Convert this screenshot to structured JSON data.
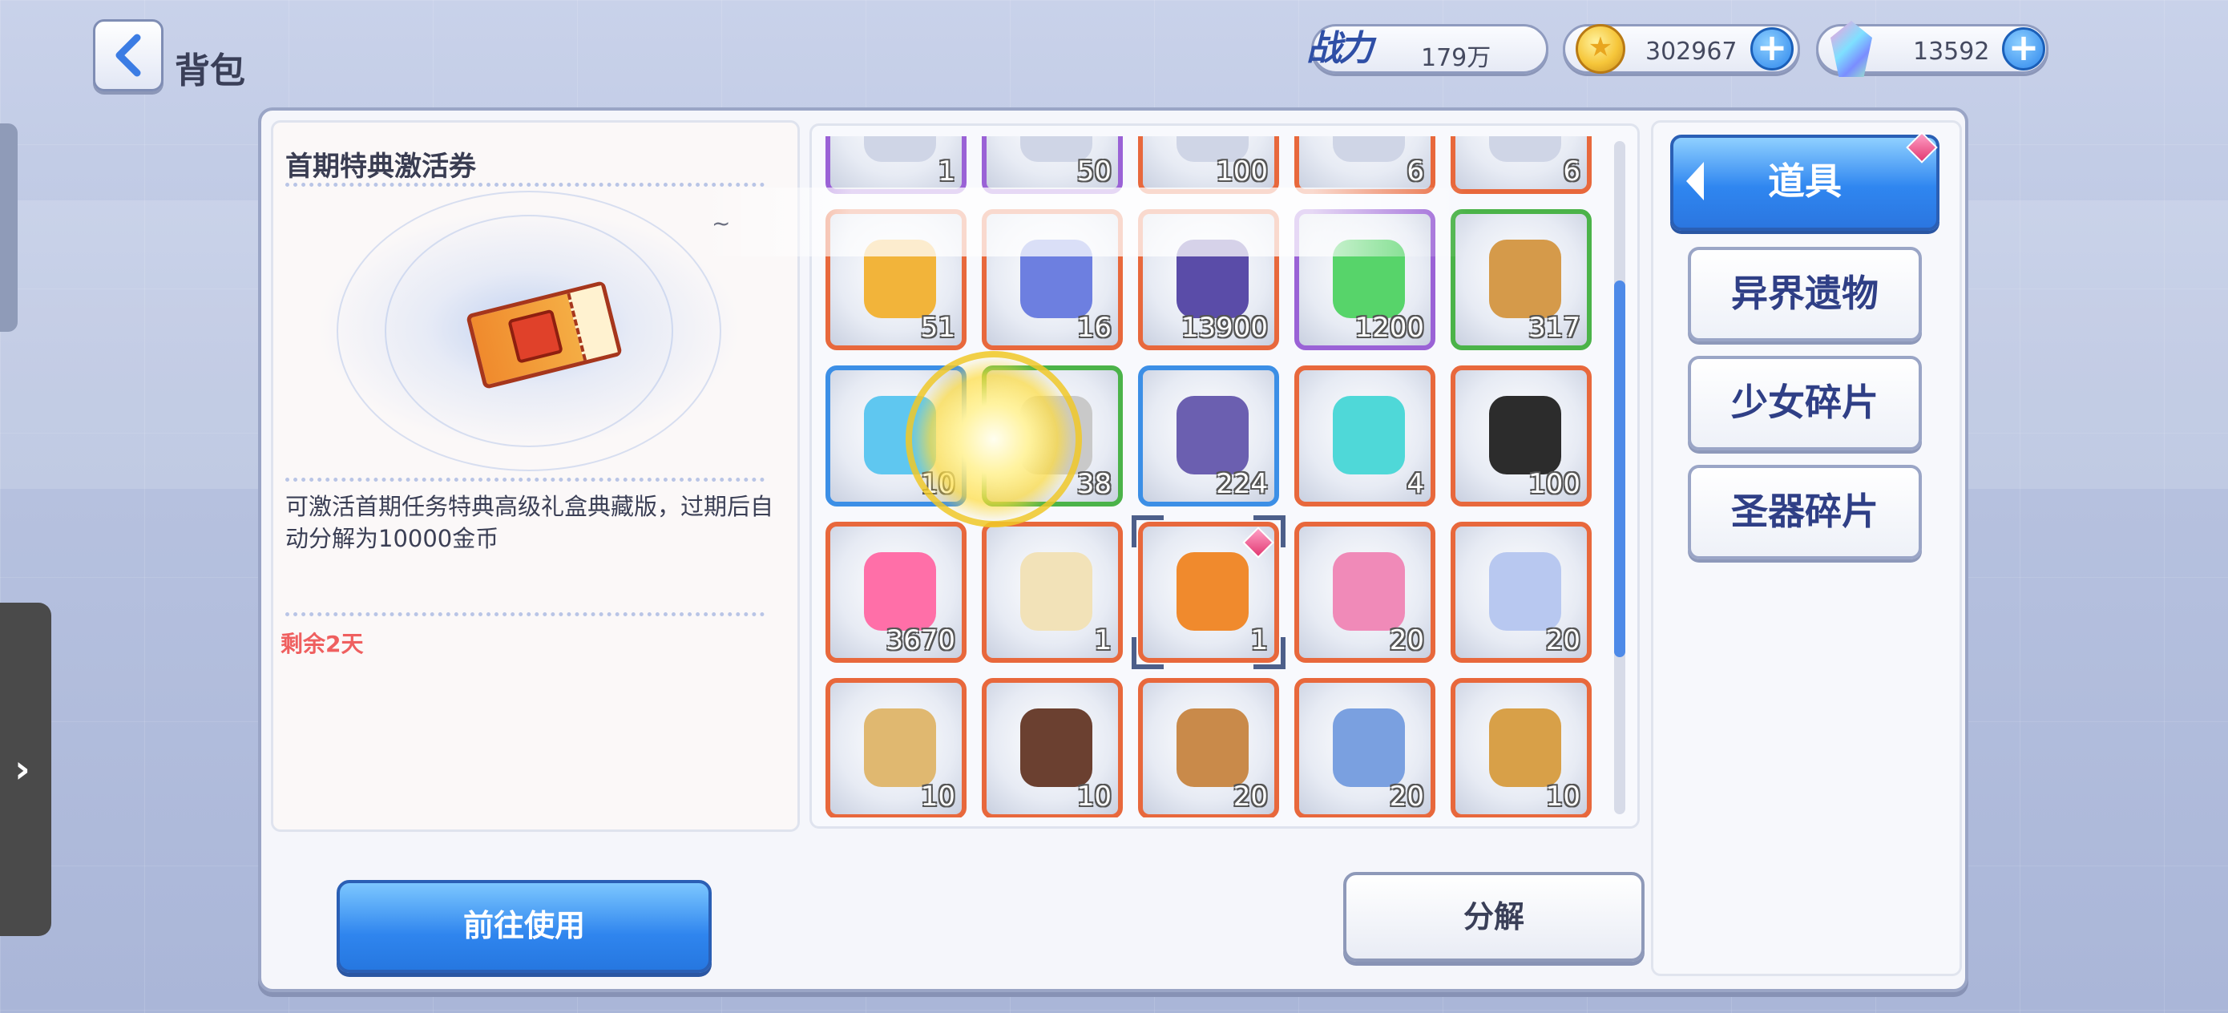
{
  "header": {
    "title": "背包",
    "power_label": "战力",
    "power_value": "179万",
    "coins": "302967",
    "gems": "13592"
  },
  "detail": {
    "name": "首期特典激活券",
    "description": "可激活首期任务特典高级礼盒典藏版，过期后自动分解为10000金币",
    "remaining": "剩余2天",
    "use_button": "前往使用",
    "floating_note": "~"
  },
  "inventory": {
    "decompose_button": "分解",
    "rows": [
      [
        {
          "count": "1",
          "rarity": "purple",
          "icon": "partial-item-icon"
        },
        {
          "count": "50",
          "rarity": "purple",
          "icon": "partial-item-icon"
        },
        {
          "count": "100",
          "rarity": "orange",
          "icon": "partial-item-icon"
        },
        {
          "count": "6",
          "rarity": "orange",
          "icon": "partial-item-icon"
        },
        {
          "count": "6",
          "rarity": "orange",
          "icon": "partial-item-icon"
        }
      ],
      [
        {
          "count": "51",
          "rarity": "orange",
          "icon": "gold-card-icon"
        },
        {
          "count": "16",
          "rarity": "orange",
          "icon": "blue-card-icon"
        },
        {
          "count": "13900",
          "rarity": "orange",
          "icon": "crystal-shard-icon"
        },
        {
          "count": "1200",
          "rarity": "purple",
          "icon": "green-vial-icon"
        },
        {
          "count": "317",
          "rarity": "green",
          "icon": "cookie-icon"
        }
      ],
      [
        {
          "count": "10",
          "rarity": "blue",
          "icon": "candy-icon"
        },
        {
          "count": "38",
          "rarity": "green",
          "icon": "gear-key-icon"
        },
        {
          "count": "224",
          "rarity": "blue",
          "icon": "cube-device-icon"
        },
        {
          "count": "4",
          "rarity": "orange",
          "icon": "cyan-vial-icon"
        },
        {
          "count": "100",
          "rarity": "orange",
          "icon": "ghost-icon"
        }
      ],
      [
        {
          "count": "3670",
          "rarity": "orange",
          "icon": "heart-icon"
        },
        {
          "count": "1",
          "rarity": "orange",
          "icon": "scroll-note-icon"
        },
        {
          "count": "1",
          "rarity": "orange",
          "icon": "ticket-icon",
          "selected": true,
          "badge": true
        },
        {
          "count": "20",
          "rarity": "orange",
          "icon": "spray-can-icon"
        },
        {
          "count": "20",
          "rarity": "orange",
          "icon": "mask-icon"
        }
      ],
      [
        {
          "count": "10",
          "rarity": "orange",
          "icon": "pocket-watch-icon"
        },
        {
          "count": "10",
          "rarity": "orange",
          "icon": "cake-icon"
        },
        {
          "count": "20",
          "rarity": "orange",
          "icon": "treasure-chest-icon"
        },
        {
          "count": "20",
          "rarity": "orange",
          "icon": "jet-icon"
        },
        {
          "count": "10",
          "rarity": "orange",
          "icon": "churro-icon"
        }
      ],
      [
        {
          "count": "",
          "rarity": "orange",
          "icon": "partial-item-icon"
        },
        {
          "count": "",
          "rarity": "orange",
          "icon": "partial-item-icon"
        },
        {
          "count": "",
          "rarity": "orange",
          "icon": "partial-item-icon"
        },
        {
          "count": "",
          "rarity": "purple",
          "icon": "partial-item-icon"
        },
        {
          "count": "",
          "rarity": "purple",
          "icon": "partial-item-icon"
        }
      ]
    ]
  },
  "tabs": [
    {
      "label": "道具",
      "active": true
    },
    {
      "label": "异界遗物"
    },
    {
      "label": "少女碎片"
    },
    {
      "label": "圣器碎片"
    }
  ],
  "colors": {
    "accent_blue": "#2f86f0",
    "remaining_red": "#ef5f5f",
    "rarity_orange": "#e8683c",
    "rarity_purple": "#9a62d6",
    "rarity_blue": "#3c8fe6",
    "rarity_green": "#4bb349"
  }
}
